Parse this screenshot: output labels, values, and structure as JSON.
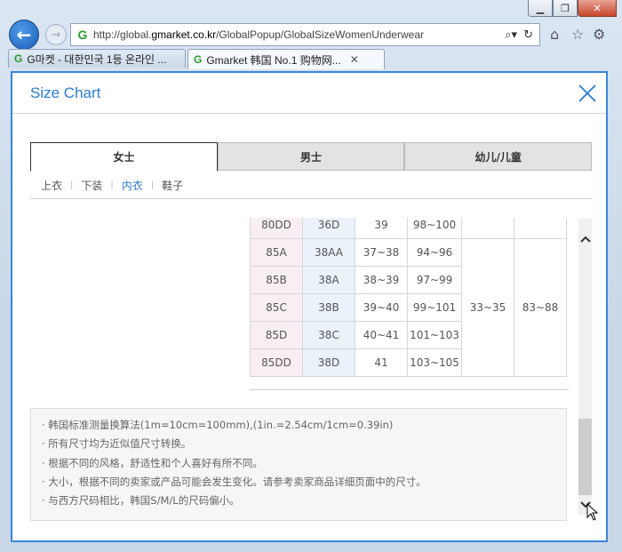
{
  "browser": {
    "url_prefix": "http://global.",
    "url_domain": "gmarket.co.kr",
    "url_path": "/GlobalPopup/GlobalSizeWomenUnderwear",
    "tabs": [
      {
        "label": "G마켓 - 대한민국 1등 온라인 ..."
      },
      {
        "label": "Gmarket 韩国 No.1 购物网...",
        "close": "✕"
      }
    ]
  },
  "popup": {
    "title": "Size Chart",
    "category_tabs": [
      "女士",
      "男士",
      "幼儿/儿童"
    ],
    "sub_nav": [
      "上衣",
      "下装",
      "内衣",
      "鞋子"
    ],
    "selected_sub": "内衣"
  },
  "table": {
    "rows": [
      {
        "c1": "80DD",
        "c2": "36D",
        "c3": "39",
        "c4": "98~100"
      },
      {
        "c1": "85A",
        "c2": "38AA",
        "c3": "37~38",
        "c4": "94~96"
      },
      {
        "c1": "85B",
        "c2": "38A",
        "c3": "38~39",
        "c4": "97~99"
      },
      {
        "c1": "85C",
        "c2": "38B",
        "c3": "39~40",
        "c4": "99~101"
      },
      {
        "c1": "85D",
        "c2": "38C",
        "c3": "40~41",
        "c4": "101~103"
      },
      {
        "c1": "85DD",
        "c2": "38D",
        "c3": "41",
        "c4": "103~105"
      }
    ],
    "merged_c5": "33~35",
    "merged_c6": "83~88"
  },
  "notes": [
    "· 韩国标准测量换算法(1m=10cm=100mm),(1in.=2.54cm/1cm=0.39in)",
    "· 所有尺寸均为近似值尺寸转换。",
    "· 根据不同的风格，舒适性和个人喜好有所不同。",
    "· 大小，根据不同的卖家或产品可能会发生变化。请参考卖家商品详细页面中的尺寸。",
    "· 与西方尺码相比，韩国S/M/L的尺码偏小。"
  ],
  "colors": {
    "accent": "#2b7bd0",
    "col1_bg": "#f8eef4",
    "col2_bg": "#eaf2fa"
  }
}
